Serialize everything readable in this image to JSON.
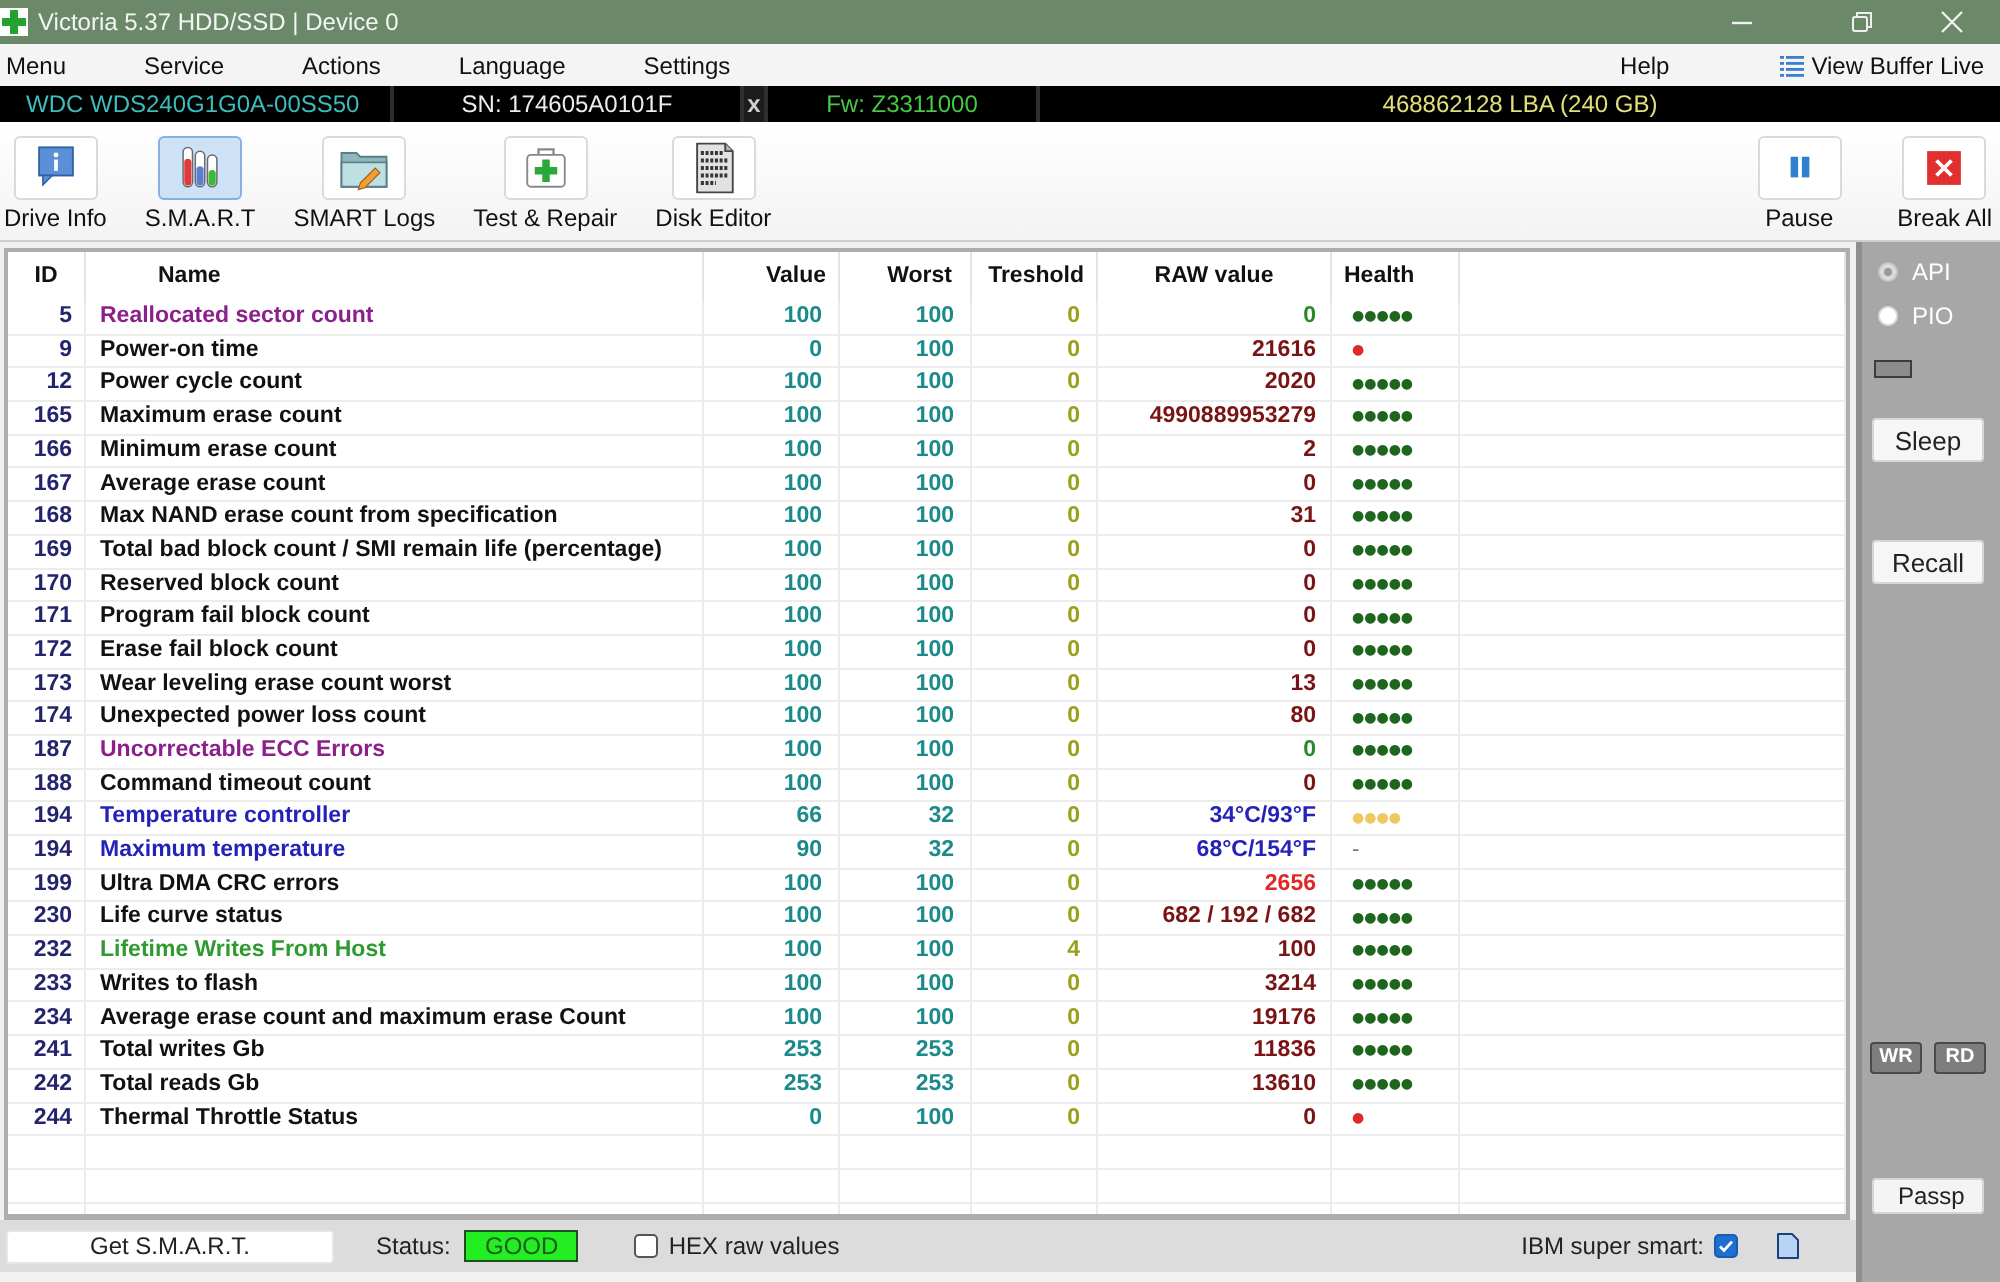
{
  "window": {
    "title": "Victoria 5.37 HDD/SSD | Device 0"
  },
  "menu": [
    "Menu",
    "Service",
    "Actions",
    "Language",
    "Settings"
  ],
  "help_menu": "Help",
  "view_buffer_button": {
    "label": "View Buffer Live"
  },
  "device_bar": {
    "model": "WDC WDS240G1G0A-00SS50",
    "serial": "SN: 174605A0101F",
    "close": "x",
    "firmware": "Fw: Z3311000",
    "capacity": "468862128 LBA (240 GB)"
  },
  "toolbar": [
    {
      "label": "Drive Info",
      "kind": "info",
      "selected": false
    },
    {
      "label": "S.M.A.R.T",
      "kind": "smart",
      "selected": true
    },
    {
      "label": "SMART Logs",
      "kind": "logs",
      "selected": false
    },
    {
      "label": "Test & Repair",
      "kind": "repair",
      "selected": false
    },
    {
      "label": "Disk Editor",
      "kind": "editor",
      "selected": false
    }
  ],
  "actions": [
    {
      "label": "Pause",
      "kind": "pause"
    },
    {
      "label": "Break All",
      "kind": "stop"
    }
  ],
  "table": {
    "columns": [
      "ID",
      "Name",
      "Value",
      "Worst",
      "Treshold",
      "RAW value",
      "Health"
    ],
    "rows": [
      {
        "id": "5",
        "name": "Reallocated sector count",
        "color": "#8b1f8b",
        "value": "100",
        "worst": "100",
        "threshold": "0",
        "raw": {
          "text": "0",
          "color": "#2a8a2a"
        },
        "health": {
          "text": "●●●●●",
          "color": "#1e651e"
        }
      },
      {
        "id": "9",
        "name": "Power-on time",
        "color": "#111111",
        "value": "0",
        "worst": "100",
        "threshold": "0",
        "raw": {
          "text": "21616",
          "color": "#7a1414"
        },
        "health": {
          "text": "●",
          "color": "#e02828"
        }
      },
      {
        "id": "12",
        "name": "Power cycle count",
        "color": "#111111",
        "value": "100",
        "worst": "100",
        "threshold": "0",
        "raw": {
          "text": "2020",
          "color": "#7a1414"
        },
        "health": {
          "text": "●●●●●",
          "color": "#1e651e"
        }
      },
      {
        "id": "165",
        "name": "Maximum erase count",
        "color": "#111111",
        "value": "100",
        "worst": "100",
        "threshold": "0",
        "raw": {
          "text": "4990889953279",
          "color": "#7a1414"
        },
        "health": {
          "text": "●●●●●",
          "color": "#1e651e"
        }
      },
      {
        "id": "166",
        "name": "Minimum erase count",
        "color": "#111111",
        "value": "100",
        "worst": "100",
        "threshold": "0",
        "raw": {
          "text": "2",
          "color": "#7a1414"
        },
        "health": {
          "text": "●●●●●",
          "color": "#1e651e"
        }
      },
      {
        "id": "167",
        "name": "Average erase count",
        "color": "#111111",
        "value": "100",
        "worst": "100",
        "threshold": "0",
        "raw": {
          "text": "0",
          "color": "#7a1414"
        },
        "health": {
          "text": "●●●●●",
          "color": "#1e651e"
        }
      },
      {
        "id": "168",
        "name": "Max NAND erase count from specification",
        "color": "#111111",
        "value": "100",
        "worst": "100",
        "threshold": "0",
        "raw": {
          "text": "31",
          "color": "#7a1414"
        },
        "health": {
          "text": "●●●●●",
          "color": "#1e651e"
        }
      },
      {
        "id": "169",
        "name": "Total bad block count / SMI remain life (percentage)",
        "color": "#111111",
        "value": "100",
        "worst": "100",
        "threshold": "0",
        "raw": {
          "text": "0",
          "color": "#7a1414"
        },
        "health": {
          "text": "●●●●●",
          "color": "#1e651e"
        }
      },
      {
        "id": "170",
        "name": "Reserved block count",
        "color": "#111111",
        "value": "100",
        "worst": "100",
        "threshold": "0",
        "raw": {
          "text": "0",
          "color": "#7a1414"
        },
        "health": {
          "text": "●●●●●",
          "color": "#1e651e"
        }
      },
      {
        "id": "171",
        "name": "Program fail block count",
        "color": "#111111",
        "value": "100",
        "worst": "100",
        "threshold": "0",
        "raw": {
          "text": "0",
          "color": "#7a1414"
        },
        "health": {
          "text": "●●●●●",
          "color": "#1e651e"
        }
      },
      {
        "id": "172",
        "name": "Erase fail block count",
        "color": "#111111",
        "value": "100",
        "worst": "100",
        "threshold": "0",
        "raw": {
          "text": "0",
          "color": "#7a1414"
        },
        "health": {
          "text": "●●●●●",
          "color": "#1e651e"
        }
      },
      {
        "id": "173",
        "name": "Wear leveling erase count worst",
        "color": "#111111",
        "value": "100",
        "worst": "100",
        "threshold": "0",
        "raw": {
          "text": "13",
          "color": "#7a1414"
        },
        "health": {
          "text": "●●●●●",
          "color": "#1e651e"
        }
      },
      {
        "id": "174",
        "name": "Unexpected power loss count",
        "color": "#111111",
        "value": "100",
        "worst": "100",
        "threshold": "0",
        "raw": {
          "text": "80",
          "color": "#7a1414"
        },
        "health": {
          "text": "●●●●●",
          "color": "#1e651e"
        }
      },
      {
        "id": "187",
        "name": "Uncorrectable ECC Errors",
        "color": "#8b1f8b",
        "value": "100",
        "worst": "100",
        "threshold": "0",
        "raw": {
          "text": "0",
          "color": "#2a8a2a"
        },
        "health": {
          "text": "●●●●●",
          "color": "#1e651e"
        }
      },
      {
        "id": "188",
        "name": "Command timeout count",
        "color": "#111111",
        "value": "100",
        "worst": "100",
        "threshold": "0",
        "raw": {
          "text": "0",
          "color": "#7a1414"
        },
        "health": {
          "text": "●●●●●",
          "color": "#1e651e"
        }
      },
      {
        "id": "194",
        "name": "Temperature controller",
        "color": "#2323b8",
        "value": "66",
        "worst": "32",
        "threshold": "0",
        "raw": {
          "text": "34°C/93°F",
          "color": "#2323b8"
        },
        "health": {
          "text": "●●●●",
          "color": "#f0c862"
        }
      },
      {
        "id": "194",
        "name": "Maximum temperature",
        "color": "#2323b8",
        "value": "90",
        "worst": "32",
        "threshold": "0",
        "raw": {
          "text": "68°C/154°F",
          "color": "#2323b8"
        },
        "health": {
          "text": "-"
        }
      },
      {
        "id": "199",
        "name": "Ultra DMA CRC errors",
        "color": "#111111",
        "value": "100",
        "worst": "100",
        "threshold": "0",
        "raw": {
          "text": "2656",
          "color": "#e02828"
        },
        "health": {
          "text": "●●●●●",
          "color": "#1e651e"
        }
      },
      {
        "id": "230",
        "name": "Life curve status",
        "color": "#111111",
        "value": "100",
        "worst": "100",
        "threshold": "0",
        "raw": {
          "text": "682 / 192 / 682",
          "color": "#7a1414"
        },
        "health": {
          "text": "●●●●●",
          "color": "#1e651e"
        }
      },
      {
        "id": "232",
        "name": "Lifetime Writes From Host",
        "color": "#2f9a2f",
        "value": "100",
        "worst": "100",
        "threshold": "4",
        "raw": {
          "text": "100",
          "color": "#7a1414"
        },
        "health": {
          "text": "●●●●●",
          "color": "#1e651e"
        }
      },
      {
        "id": "233",
        "name": "Writes to flash",
        "color": "#111111",
        "value": "100",
        "worst": "100",
        "threshold": "0",
        "raw": {
          "text": "3214",
          "color": "#7a1414"
        },
        "health": {
          "text": "●●●●●",
          "color": "#1e651e"
        }
      },
      {
        "id": "234",
        "name": "Average erase count and maximum erase Count",
        "color": "#111111",
        "value": "100",
        "worst": "100",
        "threshold": "0",
        "raw": {
          "text": "19176",
          "color": "#7a1414"
        },
        "health": {
          "text": "●●●●●",
          "color": "#1e651e"
        }
      },
      {
        "id": "241",
        "name": "Total writes Gb",
        "color": "#111111",
        "value": "253",
        "worst": "253",
        "threshold": "0",
        "raw": {
          "text": "11836",
          "color": "#7a1414"
        },
        "health": {
          "text": "●●●●●",
          "color": "#1e651e"
        }
      },
      {
        "id": "242",
        "name": "Total reads Gb",
        "color": "#111111",
        "value": "253",
        "worst": "253",
        "threshold": "0",
        "raw": {
          "text": "13610",
          "color": "#7a1414"
        },
        "health": {
          "text": "●●●●●",
          "color": "#1e651e"
        }
      },
      {
        "id": "244",
        "name": "Thermal Throttle Status",
        "color": "#111111",
        "value": "0",
        "worst": "100",
        "threshold": "0",
        "raw": {
          "text": "0",
          "color": "#7a1414"
        },
        "health": {
          "text": "●",
          "color": "#e02828"
        }
      }
    ]
  },
  "status_bar": {
    "get_smart_button": "Get S.M.A.R.T.",
    "status_label": "Status:",
    "status": "GOOD",
    "hex_raw": {
      "label": "HEX raw values",
      "checked": false
    },
    "ibm_super_smart": {
      "label": "IBM super smart:",
      "checked": true
    }
  },
  "side_panel": {
    "modes": [
      {
        "label": "API",
        "selected": true,
        "disabled": true
      },
      {
        "label": "PIO",
        "selected": false,
        "disabled": true
      }
    ],
    "sleep_button": "Sleep",
    "recall_button": "Recall",
    "io_buttons": [
      {
        "label": "WR",
        "disabled": true
      },
      {
        "label": "RD",
        "disabled": true
      }
    ],
    "bottom_button": "Passp"
  }
}
